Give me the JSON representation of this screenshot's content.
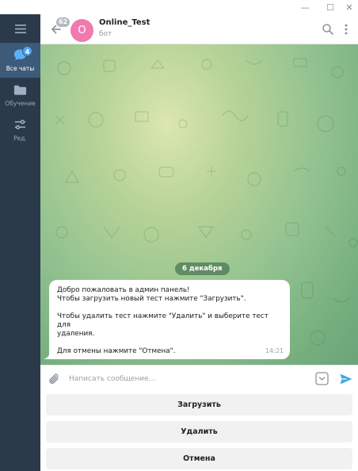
{
  "window": {
    "minimize_glyph": "—",
    "maximize_glyph": "☐",
    "close_glyph": "✕"
  },
  "sidebar": {
    "folders": [
      {
        "label": "Все чаты",
        "icon": "chats-icon",
        "badge": "4",
        "active": true
      },
      {
        "label": "Обучение",
        "icon": "folder-icon",
        "active": false
      },
      {
        "label": "Ред.",
        "icon": "edit-filters-icon",
        "active": false
      }
    ]
  },
  "header": {
    "unread_count": "62",
    "avatar_letter": "O",
    "title": "Online_Test",
    "status": "бот"
  },
  "messages": {
    "date_separator": "6 декабря",
    "items": [
      {
        "lines": [
          "Добро пожаловать в админ панель!",
          "Чтобы загрузить новый тест нажмите \"Загрузить\".",
          "",
          "Чтобы удалить тест нажмите \"Удалить\" и выберите тест для",
          "удаления.",
          "",
          "Для отмены нажмите \"Отмена\"."
        ],
        "time": "14:21"
      }
    ]
  },
  "composer": {
    "placeholder": "Написать сообщение...",
    "value": ""
  },
  "bot_keyboard": {
    "buttons": [
      "Загрузить",
      "Удалить",
      "Отмена"
    ]
  },
  "colors": {
    "sidebar_bg": "#2b3a4b",
    "sidebar_active": "#3d5a7a",
    "accent": "#4ea4f6",
    "avatar": "#ee7aae",
    "date_pill": "#4a7852"
  }
}
